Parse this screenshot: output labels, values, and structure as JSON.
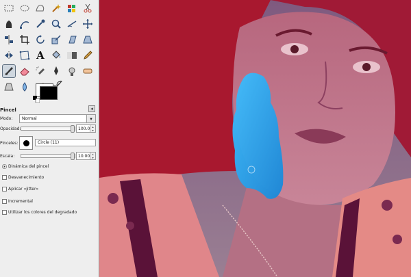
{
  "toolbox": {
    "tools": [
      {
        "name": "rect-select-icon",
        "active": false
      },
      {
        "name": "ellipse-select-icon",
        "active": false
      },
      {
        "name": "free-select-icon",
        "active": false
      },
      {
        "name": "fuzzy-select-icon",
        "active": false
      },
      {
        "name": "select-by-color-icon",
        "active": false
      },
      {
        "name": "scissors-select-icon",
        "active": false
      },
      {
        "name": "foreground-select-icon",
        "active": false
      },
      {
        "name": "paths-icon",
        "active": false
      },
      {
        "name": "color-picker-icon",
        "active": false
      },
      {
        "name": "zoom-icon",
        "active": false
      },
      {
        "name": "measure-icon",
        "active": false
      },
      {
        "name": "move-icon",
        "active": false
      },
      {
        "name": "align-icon",
        "active": false
      },
      {
        "name": "crop-icon",
        "active": false
      },
      {
        "name": "rotate-icon",
        "active": false
      },
      {
        "name": "scale-icon",
        "active": false
      },
      {
        "name": "shear-icon",
        "active": false
      },
      {
        "name": "perspective-icon",
        "active": false
      },
      {
        "name": "flip-icon",
        "active": false
      },
      {
        "name": "cage-icon",
        "active": false
      },
      {
        "name": "text-icon",
        "active": false
      },
      {
        "name": "bucket-fill-icon",
        "active": false
      },
      {
        "name": "blend-icon",
        "active": false
      },
      {
        "name": "pencil-icon",
        "active": false
      },
      {
        "name": "paintbrush-icon",
        "active": true
      },
      {
        "name": "eraser-icon",
        "active": false
      },
      {
        "name": "airbrush-icon",
        "active": false
      },
      {
        "name": "ink-icon",
        "active": false
      },
      {
        "name": "clone-icon",
        "active": false
      },
      {
        "name": "heal-icon",
        "active": false
      },
      {
        "name": "perspective-clone-icon",
        "active": false
      },
      {
        "name": "blur-icon",
        "active": false
      },
      {
        "name": "smudge-icon",
        "active": false
      },
      {
        "name": "dodge-burn-icon",
        "active": false
      }
    ],
    "text_tool_glyph": "A",
    "foreground_color": "#000000",
    "background_color": "#ffffff"
  },
  "options": {
    "title": "Pincel",
    "mode_label": "Modo:",
    "mode_value": "Normal",
    "opacity_label": "Opacidad:",
    "opacity_value": "100.0",
    "opacity_fraction": 1.0,
    "brushes_label": "Pinceles:",
    "brush_name": "Circle (11)",
    "scale_label": "Escala:",
    "scale_value": "10.00",
    "scale_fraction": 1.0,
    "dynamics_label": "Dinámica del pincel",
    "fade_label": "Desvanecimiento",
    "jitter_label": "Aplicar «jitter»",
    "incremental_label": "Incremental",
    "gradient_label": "Utilizar los colores del degradado"
  },
  "canvas": {
    "image_tint_top": "#b01e3a",
    "image_tint_bottom": "#d98a8a",
    "paint_color": "#1fa7ef"
  }
}
